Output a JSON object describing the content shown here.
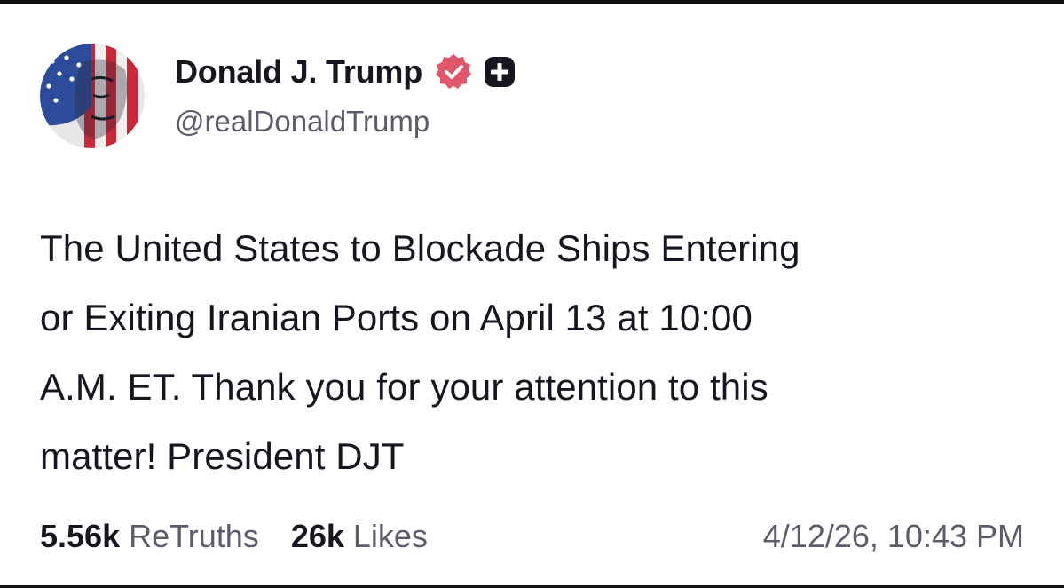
{
  "author": {
    "display_name": "Donald J. Trump",
    "handle": "@realDonaldTrump",
    "verified_icon": "verified-badge-icon",
    "plus_icon": "plus-badge-icon",
    "verified_color": "#e0566b"
  },
  "post": {
    "lines": [
      "The United States to Blockade Ships Entering",
      "or Exiting Iranian Ports on April 13 at 10:00",
      "A.M. ET. Thank you for your attention to this",
      "matter! President DJT"
    ]
  },
  "stats": {
    "retruths_count": "5.56k",
    "retruths_label": "ReTruths",
    "likes_count": "26k",
    "likes_label": "Likes"
  },
  "timestamp": "4/12/26, 10:43 PM"
}
